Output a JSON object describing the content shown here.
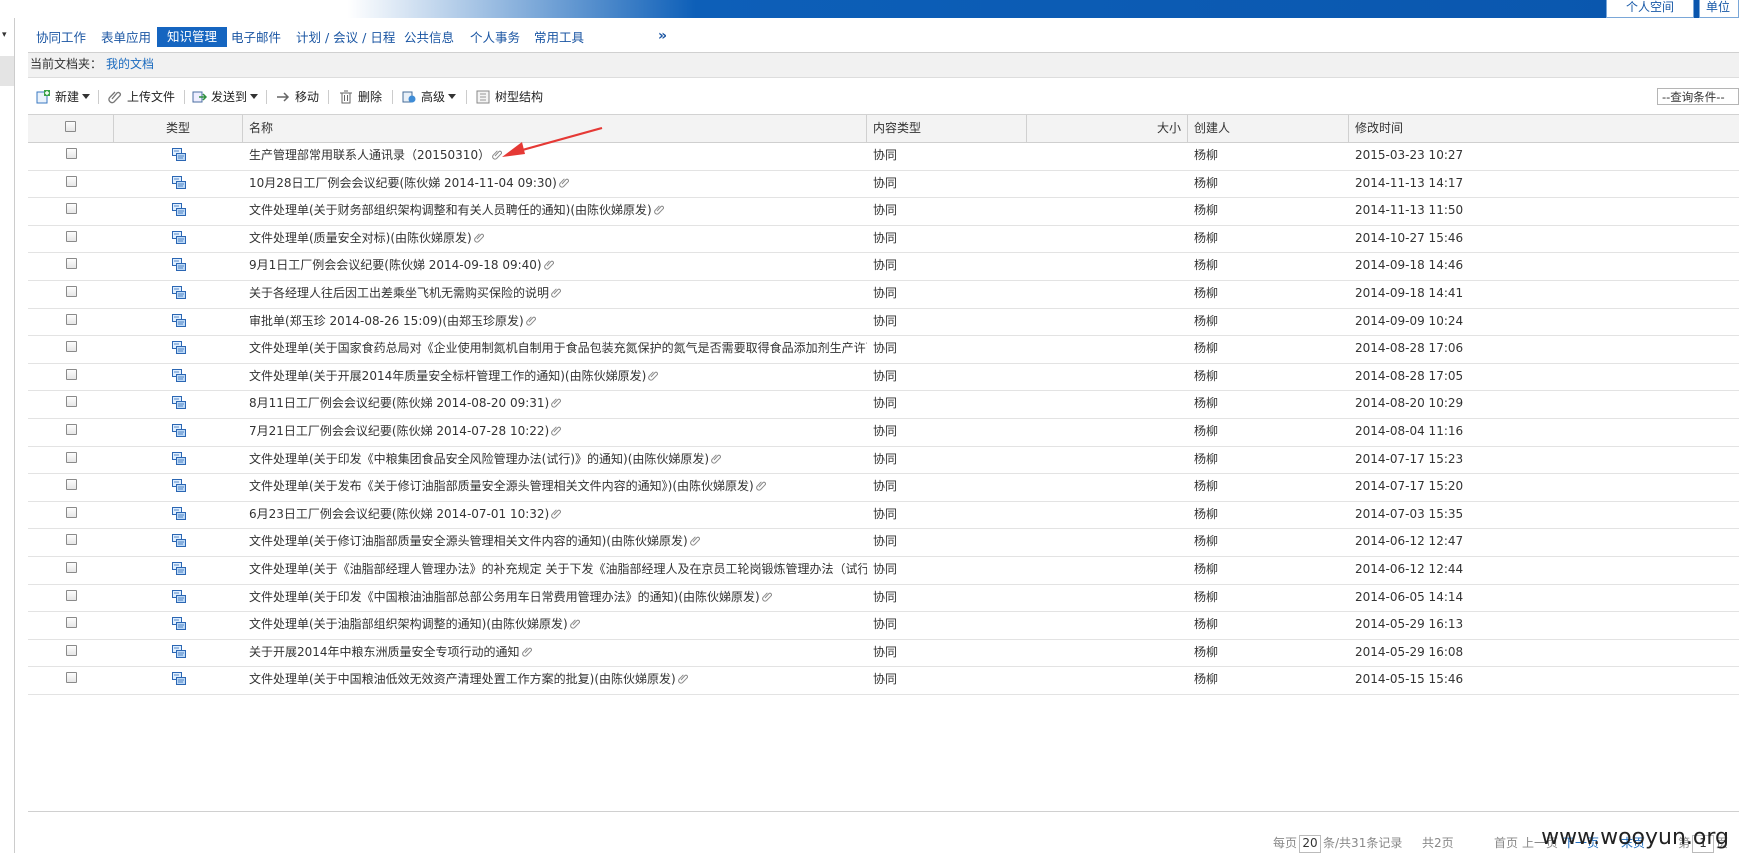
{
  "top_tabs": {
    "personal_space": "个人空间",
    "unit_space": "单位"
  },
  "menu": {
    "items": [
      "协同工作",
      "表单应用",
      "知识管理",
      "电子邮件",
      "计划 / 会议 / 日程",
      "公共信息",
      "个人事务",
      "常用工具"
    ],
    "active_index": 2,
    "more": "»"
  },
  "folder": {
    "label": "当前文档夹：",
    "value": "我的文档"
  },
  "toolbar": {
    "new": "新建",
    "upload": "上传文件",
    "send_to": "发送到",
    "move": "移动",
    "delete": "删除",
    "advanced": "高级",
    "tree": "树型结构",
    "query_placeholder": "--查询条件--"
  },
  "table": {
    "headers": {
      "type": "类型",
      "name": "名称",
      "content_type": "内容类型",
      "size": "大小",
      "creator": "创建人",
      "modified": "修改时间"
    },
    "rows": [
      {
        "name": "生产管理部常用联系人通讯录（20150310）",
        "ctype": "协同",
        "creator": "杨柳",
        "time": "2015-03-23 10:27"
      },
      {
        "name": "10月28日工厂例会会议纪要(陈伙娣 2014-11-04 09:30)",
        "ctype": "协同",
        "creator": "杨柳",
        "time": "2014-11-13 14:17"
      },
      {
        "name": "文件处理单(关于财务部组织架构调整和有关人员聘任的通知)(由陈伙娣原发)",
        "ctype": "协同",
        "creator": "杨柳",
        "time": "2014-11-13 11:50"
      },
      {
        "name": "文件处理单(质量安全对标)(由陈伙娣原发)",
        "ctype": "协同",
        "creator": "杨柳",
        "time": "2014-10-27 15:46"
      },
      {
        "name": "9月1日工厂例会会议纪要(陈伙娣 2014-09-18 09:40)",
        "ctype": "协同",
        "creator": "杨柳",
        "time": "2014-09-18 14:46"
      },
      {
        "name": "关于各经理人往后因工出差乘坐飞机无需购买保险的说明",
        "ctype": "协同",
        "creator": "杨柳",
        "time": "2014-09-18 14:41"
      },
      {
        "name": "审批单(郑玉珍 2014-08-26 15:09)(由郑玉珍原发)",
        "ctype": "协同",
        "creator": "杨柳",
        "time": "2014-09-09 10:24"
      },
      {
        "name": "文件处理单(关于国家食药总局对《企业使用制氮机自制用于食品包装充氮保护的氮气是否需要取得食品添加剂生产许可证的请示》",
        "ctype": "协同",
        "creator": "杨柳",
        "time": "2014-08-28 17:06"
      },
      {
        "name": "文件处理单(关于开展2014年质量安全标杆管理工作的通知)(由陈伙娣原发)",
        "ctype": "协同",
        "creator": "杨柳",
        "time": "2014-08-28 17:05"
      },
      {
        "name": "8月11日工厂例会会议纪要(陈伙娣 2014-08-20 09:31)",
        "ctype": "协同",
        "creator": "杨柳",
        "time": "2014-08-20 10:29"
      },
      {
        "name": "7月21日工厂例会会议纪要(陈伙娣 2014-07-28 10:22)",
        "ctype": "协同",
        "creator": "杨柳",
        "time": "2014-08-04 11:16"
      },
      {
        "name": "文件处理单(关于印发《中粮集团食品安全风险管理办法(试行)》的通知)(由陈伙娣原发)",
        "ctype": "协同",
        "creator": "杨柳",
        "time": "2014-07-17 15:23"
      },
      {
        "name": "文件处理单(关于发布《关于修订油脂部质量安全源头管理相关文件内容的通知》)(由陈伙娣原发)",
        "ctype": "协同",
        "creator": "杨柳",
        "time": "2014-07-17 15:20"
      },
      {
        "name": "6月23日工厂例会会议纪要(陈伙娣 2014-07-01 10:32)",
        "ctype": "协同",
        "creator": "杨柳",
        "time": "2014-07-03 15:35"
      },
      {
        "name": "文件处理单(关于修订油脂部质量安全源头管理相关文件内容的通知)(由陈伙娣原发)",
        "ctype": "协同",
        "creator": "杨柳",
        "time": "2014-06-12 12:47"
      },
      {
        "name": "文件处理单(关于《油脂部经理人管理办法》的补充规定 关于下发《油脂部经理人及在京员工轮岗锻炼管理办法（试行）》的通知)(",
        "ctype": "协同",
        "creator": "杨柳",
        "time": "2014-06-12 12:44"
      },
      {
        "name": "文件处理单(关于印发《中国粮油油脂部总部公务用车日常费用管理办法》的通知)(由陈伙娣原发)",
        "ctype": "协同",
        "creator": "杨柳",
        "time": "2014-06-05 14:14"
      },
      {
        "name": "文件处理单(关于油脂部组织架构调整的通知)(由陈伙娣原发)",
        "ctype": "协同",
        "creator": "杨柳",
        "time": "2014-05-29 16:13"
      },
      {
        "name": "关于开展2014年中粮东洲质量安全专项行动的通知",
        "ctype": "协同",
        "creator": "杨柳",
        "time": "2014-05-29 16:08"
      },
      {
        "name": "文件处理单(关于中国粮油低效无效资产清理处置工作方案的批复)(由陈伙娣原发)",
        "ctype": "协同",
        "creator": "杨柳",
        "time": "2014-05-15 15:46"
      }
    ]
  },
  "pager": {
    "per_page_label": "每页",
    "per_page_value": "20",
    "summary": "条/共31条记录",
    "pages": "共2页",
    "first": "首页",
    "prev": "上一页",
    "next": "下一页",
    "last": "末页",
    "goto": "第",
    "goto_value": "1",
    "page_suffix": "页"
  },
  "watermark": "www.wooyun.org",
  "colors": {
    "accent": "#1565c0",
    "link": "#1b6bbf",
    "annotation_arrow": "#e53935"
  }
}
